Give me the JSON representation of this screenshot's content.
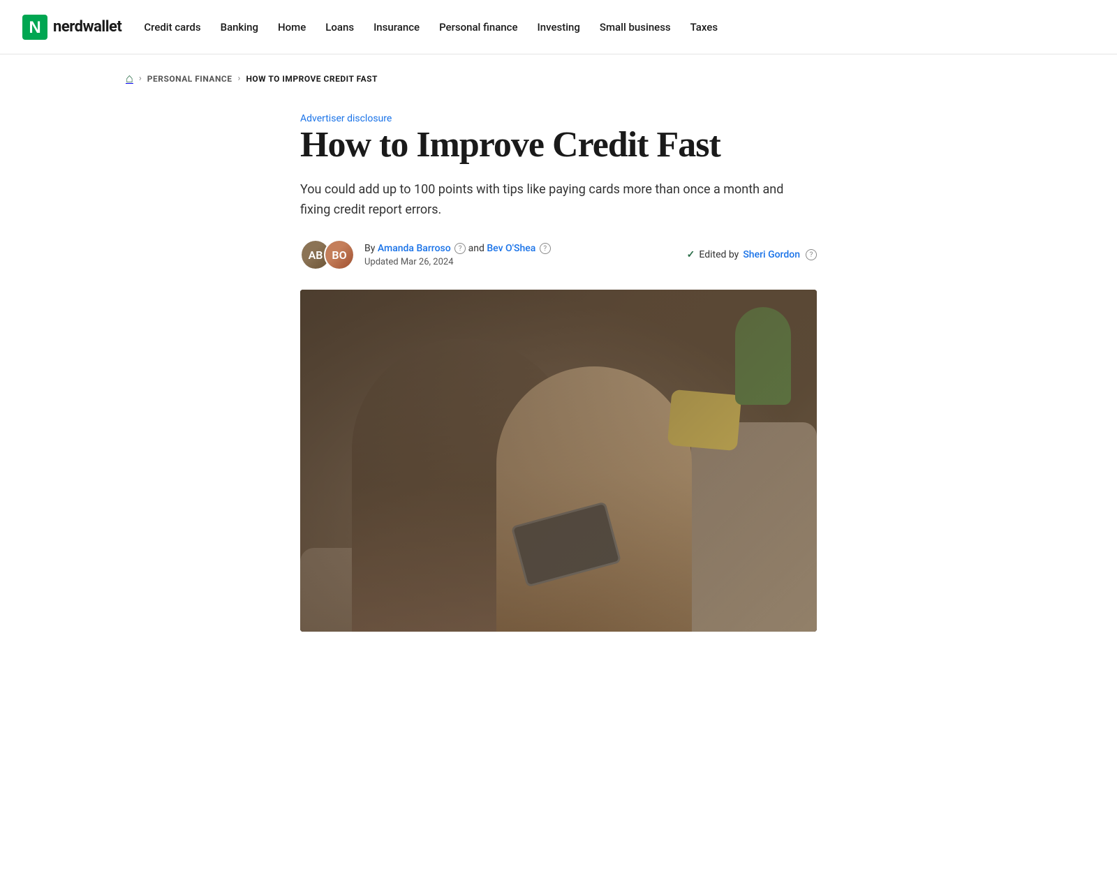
{
  "nav": {
    "logo_text": "nerdwallet",
    "links": [
      {
        "label": "Credit cards",
        "id": "credit-cards"
      },
      {
        "label": "Banking",
        "id": "banking"
      },
      {
        "label": "Home",
        "id": "home"
      },
      {
        "label": "Loans",
        "id": "loans"
      },
      {
        "label": "Insurance",
        "id": "insurance"
      },
      {
        "label": "Personal finance",
        "id": "personal-finance"
      },
      {
        "label": "Investing",
        "id": "investing"
      },
      {
        "label": "Small business",
        "id": "small-business"
      },
      {
        "label": "Taxes",
        "id": "taxes"
      }
    ]
  },
  "breadcrumb": {
    "home_icon": "🏠",
    "personal_finance_label": "Personal Finance",
    "current_label": "How to Improve Credit Fast"
  },
  "article": {
    "advertiser_disclosure": "Advertiser disclosure",
    "title": "How to Improve Credit Fast",
    "subtitle": "You could add up to 100 points with tips like paying cards more than once a month and fixing credit report errors.",
    "byline_prefix": "By",
    "author1_name": "Amanda Barroso",
    "byline_connector": "and",
    "author2_name": "Bev O'Shea",
    "edited_prefix": "Edited by",
    "editor_name": "Sheri Gordon",
    "updated_label": "Updated Mar 26, 2024",
    "avatar1_initials": "AB",
    "avatar2_initials": "BO"
  }
}
